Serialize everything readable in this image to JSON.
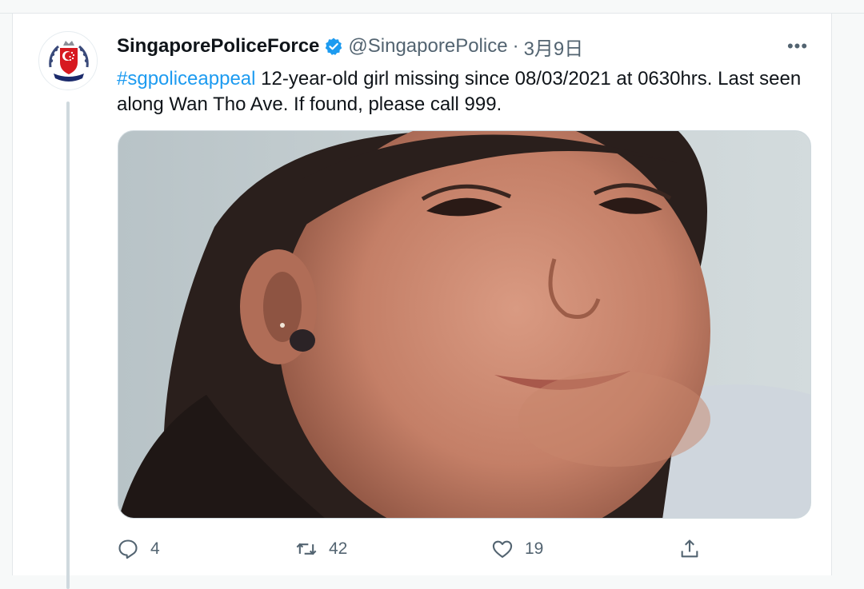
{
  "tweet": {
    "author": {
      "display_name": "SingaporePoliceForce",
      "handle": "@SingaporePolice",
      "verified": true,
      "avatar_icon": "police-crest-icon"
    },
    "separator": "·",
    "date": "3月9日",
    "text": {
      "hashtag": "#sgpoliceappeal",
      "body": " 12-year-old girl missing since 08/03/2021 at 0630hrs. Last seen along Wan Tho Ave. If found, please call 999."
    },
    "media": {
      "alt_icon": "photo-of-missing-girl"
    },
    "actions": {
      "reply": {
        "icon": "reply-icon",
        "count": "4"
      },
      "retweet": {
        "icon": "retweet-icon",
        "count": "42"
      },
      "like": {
        "icon": "heart-icon",
        "count": "19"
      },
      "share": {
        "icon": "share-icon"
      }
    },
    "more_label": "•••"
  },
  "colors": {
    "accent": "#1d9bf0",
    "text_primary": "#0f1419",
    "text_secondary": "#536471",
    "crest_red": "#d71920",
    "crest_blue": "#1b2a6b"
  }
}
